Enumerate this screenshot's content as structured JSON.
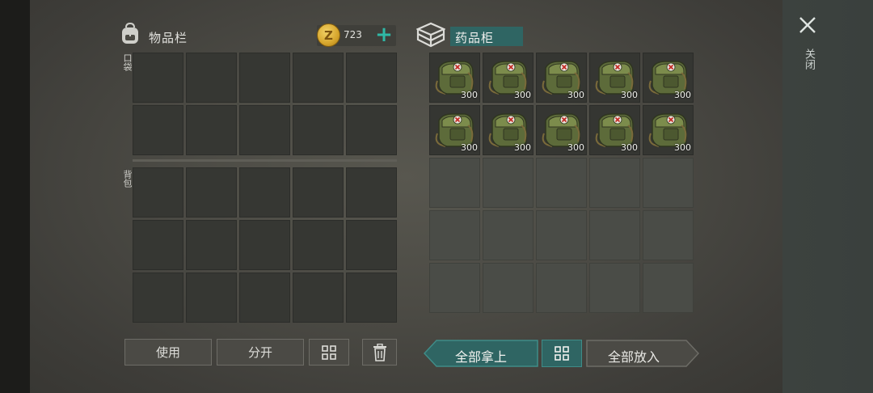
{
  "inventory": {
    "title": "物品栏",
    "icon": "backpack-icon",
    "coins": "723",
    "pocket_label": "口袋",
    "backpack_label": "背包"
  },
  "cabinet": {
    "title": "药品柜",
    "icon": "cabinet-icon",
    "items": [
      {
        "name": "medkit-bag-icon",
        "qty": "300"
      },
      {
        "name": "medkit-bag-icon",
        "qty": "300"
      },
      {
        "name": "medkit-bag-icon",
        "qty": "300"
      },
      {
        "name": "medkit-bag-icon",
        "qty": "300"
      },
      {
        "name": "medkit-bag-icon",
        "qty": "300"
      },
      {
        "name": "medkit-bag-icon",
        "qty": "300"
      },
      {
        "name": "medkit-bag-icon",
        "qty": "300"
      },
      {
        "name": "medkit-bag-icon",
        "qty": "300"
      },
      {
        "name": "medkit-bag-icon",
        "qty": "300"
      },
      {
        "name": "medkit-bag-icon",
        "qty": "300"
      }
    ]
  },
  "buttons": {
    "use": "使用",
    "split": "分开",
    "take_all": "全部拿上",
    "put_all": "全部放入"
  },
  "close_label": "关闭",
  "colors": {
    "accent_teal": "#2f6563",
    "plus_teal": "#2fb8a6",
    "coin_gold": "#d6a52c"
  }
}
